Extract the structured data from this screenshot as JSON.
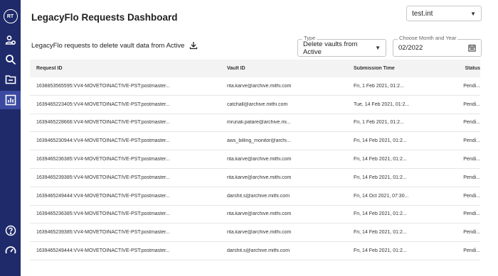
{
  "sidebar": {
    "avatar_initials": "RT",
    "items": [
      {
        "icon": "users-settings-icon"
      },
      {
        "icon": "search-icon"
      },
      {
        "icon": "folder-icon"
      },
      {
        "icon": "chart-icon",
        "active": true
      }
    ],
    "bottom": [
      {
        "icon": "help-icon"
      },
      {
        "icon": "speedometer-icon"
      }
    ]
  },
  "header": {
    "title": "LegacyFlo Requests Dashboard",
    "tenant": "test.int"
  },
  "toolbar": {
    "subtitle": "LegacyFlo requests to delete vault data from Active",
    "type_label": "Type",
    "type_value": "Delete vaults from Active",
    "date_label": "Choose Month and Year",
    "date_value": "02/2022"
  },
  "table": {
    "headers": {
      "request_id": "Request ID",
      "vault_id": "Vault ID",
      "submission_time": "Submission Time",
      "status": "Status"
    },
    "rows": [
      {
        "request_id": "1638853565595:VV4-MOVETOINACTIVE-PST:postmaster...",
        "vault_id": "rita.karve@archive.mithi.com",
        "submission_time": "Fri, 1 Feb 2021, 01:2...",
        "status": "Pendi..."
      },
      {
        "request_id": "1639465223405:VV4-MOVETOINACTIVE-PST:postmaster...",
        "vault_id": "catchall@archive.mithi.com",
        "submission_time": "Tue, 14 Feb 2021, 01:2...",
        "status": "Pendi..."
      },
      {
        "request_id": "1639465228666:VV4-MOVETOINACTIVE-PST:postmaster...",
        "vault_id": "mrunali.patare@archive.mi...",
        "submission_time": "Fri, 1 Feb 2021, 01:2...",
        "status": "Pendi..."
      },
      {
        "request_id": "1639465230944:VV4-MOVETOINACTIVE-PST:postmaster...",
        "vault_id": "aws_billing_monitor@archi...",
        "submission_time": "Fri, 14 Feb 2021, 01:2...",
        "status": "Pendi..."
      },
      {
        "request_id": "1639465236385:VV4-MOVETOINACTIVE-PST:postmaster...",
        "vault_id": "rita.karve@archive.mithi.com",
        "submission_time": "Fri, 14 Feb 2021, 01:2...",
        "status": "Pendi..."
      },
      {
        "request_id": "1639465239385:VV4-MOVETOINACTIVE-PST:postmaster...",
        "vault_id": "rita.karve@archive.mithi.com",
        "submission_time": "Fri, 14 Feb 2021, 01:2...",
        "status": "Pendi..."
      },
      {
        "request_id": "1639465249444:VV4-MOVETOINACTIVE-PST:postmaster...",
        "vault_id": "darshit.s@archive.mithi.com",
        "submission_time": "Fri, 14 Oct 2021, 07:30...",
        "status": "Pendi..."
      },
      {
        "request_id": "1639465236385:VV4-MOVETOINACTIVE-PST:postmaster...",
        "vault_id": "rita.karve@archive.mithi.com",
        "submission_time": "Fri, 14 Feb 2021, 01:2...",
        "status": "Pendi..."
      },
      {
        "request_id": "1639465239385:VV4-MOVETOINACTIVE-PST:postmaster...",
        "vault_id": "rita.karve@archive.mithi.com",
        "submission_time": "Fri, 14 Feb 2021, 01:2...",
        "status": "Pendi..."
      },
      {
        "request_id": "1639465249444:VV4-MOVETOINACTIVE-PST:postmaster...",
        "vault_id": "darshit.s@archive.mithi.com",
        "submission_time": "Fri, 14 Feb 2021, 01:2...",
        "status": "Pendi..."
      }
    ]
  },
  "colors": {
    "sidebar_bg": "#1f2a6b",
    "sidebar_active": "#3b4aa0"
  }
}
